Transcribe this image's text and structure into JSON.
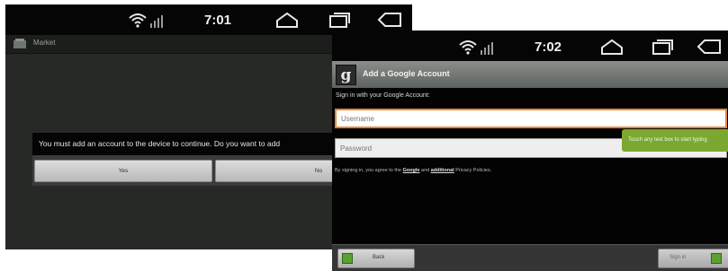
{
  "screen1": {
    "status": {
      "time": "7:01"
    },
    "appbar": {
      "title": "Market",
      "icon": "market-icon"
    },
    "dialog": {
      "message": "You must add an account to the device to continue. Do you want to add",
      "yes_label": "Yes",
      "no_label": "No"
    }
  },
  "screen2": {
    "status": {
      "time": "7:02"
    },
    "titlebar": {
      "icon_letter": "g",
      "title": "Add a Google Account"
    },
    "subtitle": "Sign in with your Google Account:",
    "username": {
      "placeholder": "Username"
    },
    "password": {
      "placeholder": "Password"
    },
    "tooltip": "Touch any text box to start typing",
    "terms": {
      "prefix": "By signing in, you agree to the ",
      "link1": "Google",
      "middle": " and ",
      "link2": "additional",
      "suffix": " Privacy Policies."
    },
    "buttons": {
      "back_label": "Back",
      "signin_label": "Sign in"
    }
  },
  "colors": {
    "status_bar": "#050505",
    "dialog_bg": "#050505",
    "focus_border": "#e8862a",
    "tooltip_green": "#7ba832",
    "check_green": "#5aa132"
  }
}
